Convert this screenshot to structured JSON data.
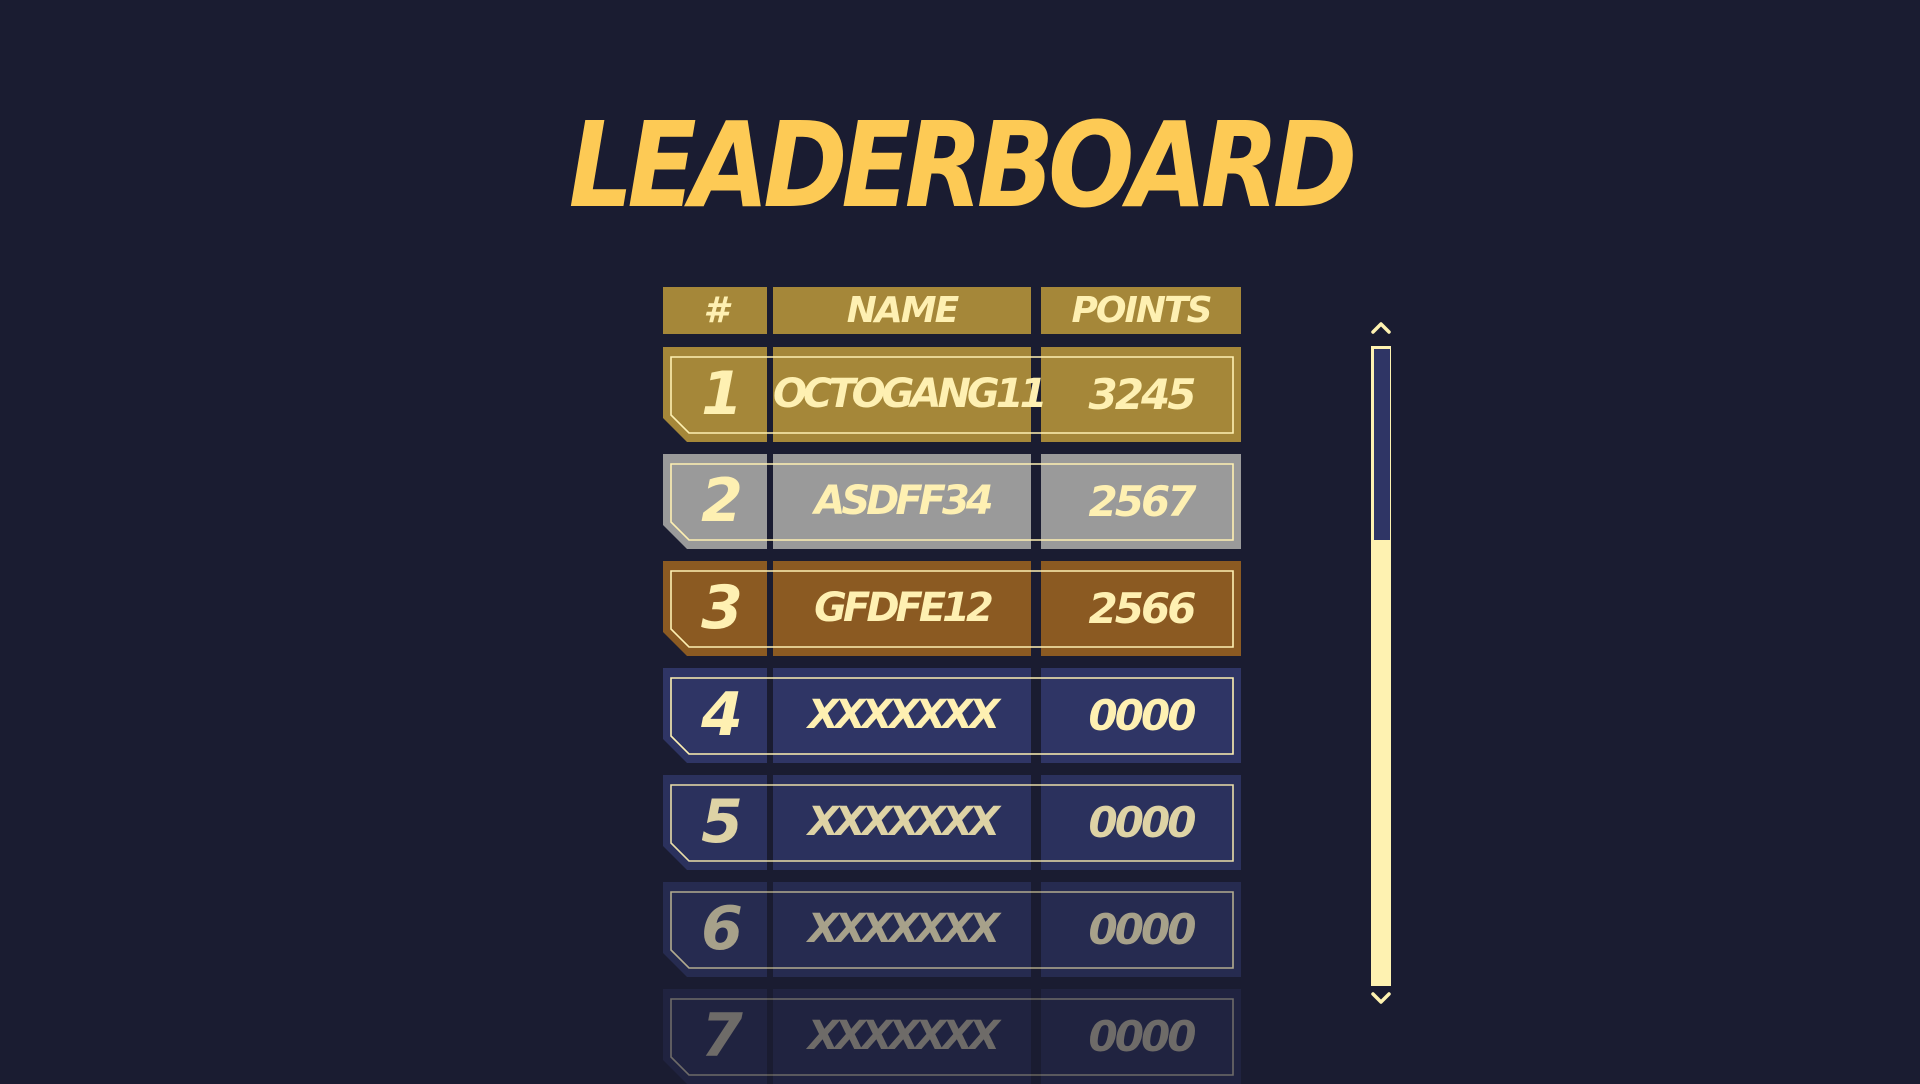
{
  "title": "LEADERBOARD",
  "header": {
    "rank": "#",
    "name": "NAME",
    "points": "POINTS"
  },
  "rows": [
    {
      "rank": "1",
      "name": "OCTOGANG11",
      "points": "3245"
    },
    {
      "rank": "2",
      "name": "ASDFF34",
      "points": "2567"
    },
    {
      "rank": "3",
      "name": "GFDFE12",
      "points": "2566"
    },
    {
      "rank": "4",
      "name": "XXXXXXX",
      "points": "0000"
    },
    {
      "rank": "5",
      "name": "XXXXXXX",
      "points": "0000"
    },
    {
      "rank": "6",
      "name": "XXXXXXX",
      "points": "0000"
    },
    {
      "rank": "7",
      "name": "XXXXXXX",
      "points": "0000"
    }
  ],
  "colors": {
    "background": "#1a1c31",
    "title": "#fdca55",
    "header": "#a58739",
    "gold": "#a58739",
    "silver": "#9a9a9a",
    "bronze": "#8b5a22",
    "default_row": "#2f3565",
    "text": "#fef0b2"
  },
  "icons": {
    "scroll_up": "chevron-up-icon",
    "scroll_down": "chevron-down-icon"
  },
  "scrollbar": {
    "thumb_fraction": 0.3,
    "position_fraction": 0.0
  }
}
